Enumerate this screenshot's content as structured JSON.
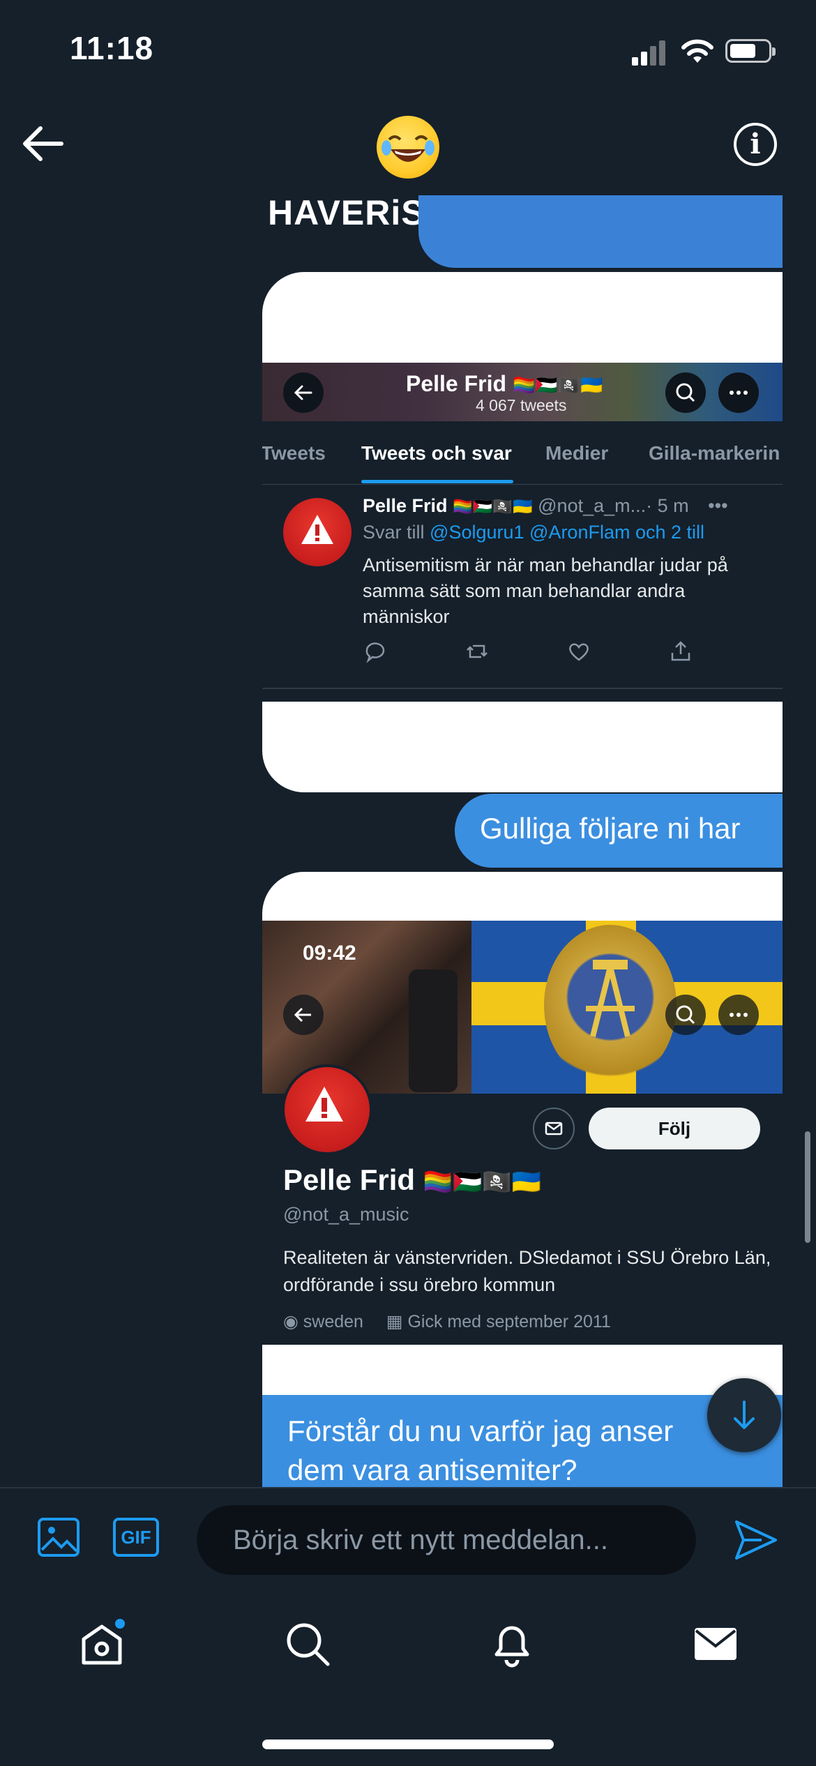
{
  "status_bar": {
    "time": "11:18"
  },
  "header": {
    "title": "HAVERiSTERNA",
    "back_icon": "arrow-left-icon",
    "info_icon": "info-icon",
    "avatar_icon": "laughing-emoji-icon"
  },
  "card1": {
    "name": "Pelle Frid",
    "flags": "🏳️‍🌈🇵🇸🏴‍☠️🇺🇦",
    "tweet_count": "4 067 tweets",
    "tabs": [
      "Tweets",
      "Tweets och svar",
      "Medier",
      "Gilla-markerin"
    ],
    "active_tab": "Tweets och svar",
    "tweet": {
      "handle": "@not_a_m...",
      "time": "· 5 m",
      "reply_prefix": "Svar till",
      "reply_to": "@Solguru1 @AronFlam och 2 till",
      "text": "Antisemitism är när man behandlar judar på samma sätt som man behandlar andra människor"
    }
  },
  "messages": {
    "msg1": "Gulliga följare ni har",
    "msg2": "Förstår du nu varför jag anser dem vara antisemiter?"
  },
  "card2": {
    "time": "09:42",
    "follow_label": "Följ",
    "name": "Pelle Frid",
    "flags": "🏳️‍🌈🇵🇸🏴‍☠️🇺🇦",
    "handle": "@not_a_music",
    "bio": "Realiteten är vänstervriden. DSledamot i SSU Örebro Län, ordförande i ssu örebro kommun",
    "location": "sweden",
    "joined": "Gick med september 2011"
  },
  "composer": {
    "gif_label": "GIF",
    "placeholder": "Börja skriv ett nytt meddelan..."
  },
  "tabbar": {
    "items": [
      "home-icon",
      "search-icon",
      "bell-icon",
      "mail-icon"
    ]
  }
}
